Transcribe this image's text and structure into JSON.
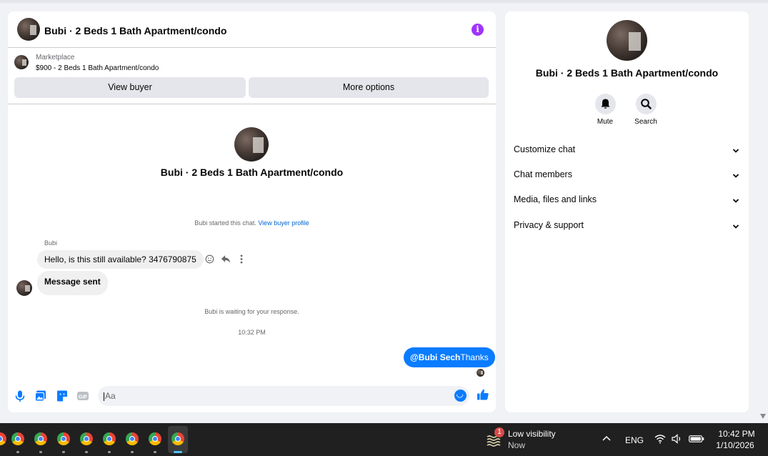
{
  "chat": {
    "title": "Bubi · 2 Beds 1 Bath Apartment/condo",
    "marketplace_label": "Marketplace",
    "listing": "$900 - 2 Beds 1 Bath Apartment/condo",
    "view_buyer": "View buyer",
    "more_options": "More options",
    "center_name": "Bubi · 2 Beds 1 Bath Apartment/condo",
    "started_text": "Bubi started this chat.",
    "view_buyer_profile": "View buyer profile",
    "sender_name": "Bubi",
    "messages_in": [
      "Hello, is this still available? 3476790875",
      "Message sent"
    ],
    "waiting_text": "Bubi is waiting for your response.",
    "timestamp": "10:32 PM",
    "out_mention": "@Bubi Sech",
    "out_text": "Thanks",
    "input_placeholder": "Aa"
  },
  "info_panel": {
    "name": "Bubi · 2 Beds 1 Bath Apartment/condo",
    "mute_label": "Mute",
    "search_label": "Search",
    "sections": [
      "Customize chat",
      "Chat members",
      "Media, files and links",
      "Privacy & support"
    ]
  },
  "taskbar": {
    "weather_badge": "1",
    "weather_title": "Low visibility",
    "weather_sub": "Now",
    "language": "ENG",
    "time": "10:42 PM",
    "date": "1/10/2026"
  },
  "colors": {
    "accent": "#0a7cff",
    "info_icon": "#a033ff",
    "link": "#0064d1"
  }
}
